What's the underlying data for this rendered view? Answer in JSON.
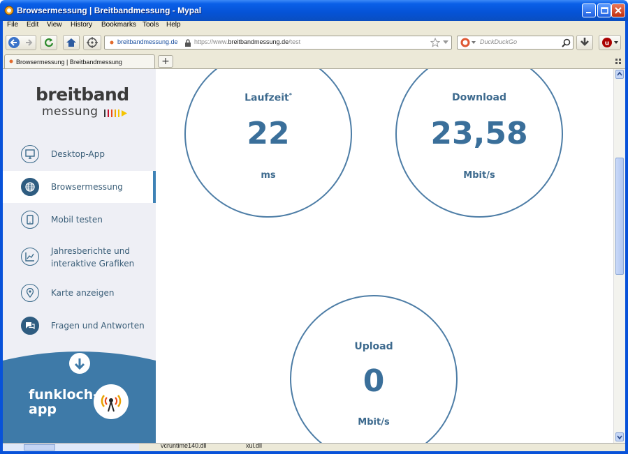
{
  "window": {
    "title": "Browsermessung | Breitbandmessung - Mypal"
  },
  "menu": [
    "File",
    "Edit",
    "View",
    "History",
    "Bookmarks",
    "Tools",
    "Help"
  ],
  "navbar": {
    "site_identity": "breitbandmessung.de",
    "url_prefix": "https://www.",
    "url_domain": "breitbandmessung.de",
    "url_path": "/test",
    "search_placeholder": "DuckDuckGo"
  },
  "tab": {
    "title": "Browsermessung | Breitbandmessung"
  },
  "sidebar": {
    "logo_top": "breitband",
    "logo_bottom": "messung",
    "items": [
      {
        "label": "Desktop-App",
        "icon": "monitor-icon",
        "active": false
      },
      {
        "label": "Browsermessung",
        "icon": "globe-icon",
        "active": true
      },
      {
        "label": "Mobil testen",
        "icon": "phone-icon",
        "active": false
      },
      {
        "label": "Jahresberichte und\ninteraktive Grafiken",
        "icon": "chart-icon",
        "active": false
      },
      {
        "label": "Karte anzeigen",
        "icon": "map-pin-icon",
        "active": false
      },
      {
        "label": "Fragen und Antworten",
        "icon": "chat-icon",
        "active": false
      }
    ],
    "promo_line1": "funkloch-",
    "promo_line2": "app"
  },
  "results": {
    "latency": {
      "label": "Laufzeit",
      "footnote": "*",
      "value": "22",
      "unit": "ms"
    },
    "download": {
      "label": "Download",
      "value": "23,58",
      "unit": "Mbit/s"
    },
    "upload": {
      "label": "Upload",
      "value": "0",
      "unit": "Mbit/s"
    }
  },
  "statusbar": {
    "item1": "vcruntime140.dll",
    "item2": "xul.dll"
  },
  "colors": {
    "accent": "#3e82b6",
    "gauge_text": "#3a6f9a",
    "sidebar_bg": "#eeeff5",
    "promo_bg": "#3e7aa8"
  }
}
